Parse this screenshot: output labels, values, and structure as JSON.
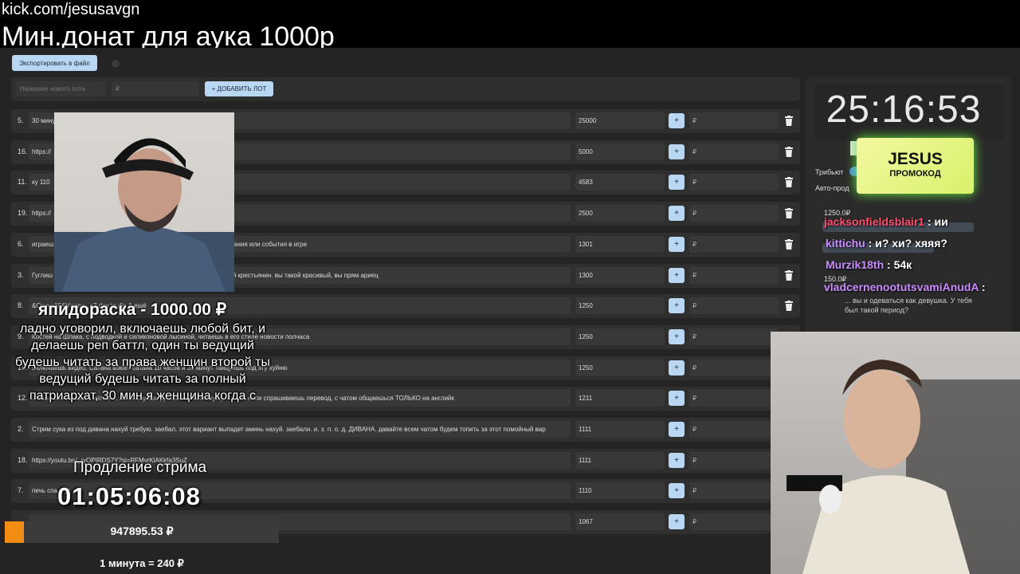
{
  "stream": {
    "url": "kick.com/jesusavgn",
    "title": "Мин.донат для аука 1000р"
  },
  "toolbar": {
    "export_label": "Экспортировать в файл"
  },
  "add_lot": {
    "name_placeholder": "Название нового лота",
    "amount_placeholder": "₽",
    "button_label": "+ ДОБАВИТЬ ЛОТ"
  },
  "lots": [
    {
      "num": "5.",
      "name": "30 минут ... ю я тебе в тг скинул",
      "amount": "25000",
      "plus": "+",
      "add_placeholder": "₽"
    },
    {
      "num": "16.",
      "name": "https://",
      "amount": "5000",
      "plus": "+",
      "add_placeholder": "₽"
    },
    {
      "num": "11.",
      "name": "ку 110",
      "amount": "4583",
      "plus": "+",
      "add_placeholder": "₽"
    },
    {
      "num": "19.",
      "name": "https://",
      "amount": "2500",
      "plus": "+",
      "add_placeholder": "₽"
    },
    {
      "num": "6.",
      "name": "играеш ... он твой компаньон читаешь донаты там тебе донатят задания или события в игре",
      "amount": "1301",
      "plus": "+",
      "add_placeholder": "₽"
    },
    {
      "num": "3.",
      "name": "Гуглиш ... фотками говоришь. Господи, какой вы ариец, а я беззубый крестьянин. вы такой красивый, вы прям ариец",
      "amount": "1300",
      "plus": "+",
      "add_placeholder": "₽"
    },
    {
      "num": "8.",
      "name": "&Осуче15&Vлоди...е7 day to die & ещё",
      "amount": "1250",
      "plus": "+",
      "add_placeholder": "₽"
    },
    {
      "num": "9.",
      "name": "Костей на Шлака, с подводкой и силиконовой лысиной, читаешь в его стиле новости полчаса",
      "amount": "1250",
      "plus": "+",
      "add_placeholder": "₽"
    },
    {
      "num": "15.",
      "name": "Включаешь видео. Сатана воюет сатана 10 часов и 30 минут танцуешь под эту хуйню",
      "amount": "1250",
      "plus": "+",
      "add_placeholder": "₽"
    },
    {
      "num": "12.",
      "name": "Учишь английский с чатом ... используешь русский по минимуму, только если спрашиваешь перевод, с чатом общаешься ТОЛЬКО на английк",
      "amount": "1211",
      "plus": "+",
      "add_placeholder": "₽"
    },
    {
      "num": "2.",
      "name": "Стрим сука из под дивана нахуй требую. заебал. этот вариант выпадет аминь нахуй. заебали. и. з. п. о. д. ДИВАНА. давайте всем чатом будем топить за этот помойный вар",
      "amount": "1111",
      "plus": "+",
      "add_placeholder": "₽"
    },
    {
      "num": "18.",
      "name": "https://youtu.be/_ryOPIRDS7Y?si=RFMvrKlAKkfa3SuZ",
      "amount": "1111",
      "plus": "+",
      "add_placeholder": "₽"
    },
    {
      "num": "7.",
      "name": "печь спа... ут",
      "amount": "1110",
      "plus": "+",
      "add_placeholder": "₽"
    },
    {
      "num": "",
      "name": "",
      "amount": "1067",
      "plus": "+",
      "add_placeholder": "₽"
    }
  ],
  "timer": {
    "value": "25:16:53",
    "tribute_label": "Трибьют",
    "auto_label": "Авто-прод"
  },
  "promo": {
    "title": "JESUS",
    "subtitle": "ПРОМОКОД"
  },
  "chat": {
    "lines": [
      {
        "amount": "1250.0₽",
        "user": "jacksonfieldsblair1",
        "text": " : ии",
        "color": "#ff4d6d"
      },
      {
        "amount": "",
        "user": "kittichu",
        "text": " : и? хи? хяяя?",
        "color": "#c98cff"
      },
      {
        "amount": "",
        "user": "Murzik18th",
        "text": " : 54к",
        "color": "#c98cff"
      },
      {
        "amount": "150.0₽",
        "user": "vladcernenootutsvamiAnudA",
        "text": " :",
        "color": "#c98cff"
      }
    ],
    "sub_text": "... вы и одеваться как девушка. У тебя был такой период?"
  },
  "donation": {
    "title": "япидораска - 1000.00 ₽",
    "message": "ладно уговорил, включаешь любой бит, и делаешь реп баттл, один ты ведущий будешь читать за права женщин второй ты ведущий будешь читать за полный патриархат, 30 мин я женщина когда с"
  },
  "extension": {
    "label": "Продление стрима",
    "timer": "01:05:06:08"
  },
  "total": {
    "value": "947895.53 ₽",
    "progress": 0.07,
    "fill_color": "#f28c13"
  },
  "rate": {
    "text": "1 минута = 240 ₽"
  },
  "colors": {
    "accent": "#b9d6f2",
    "panel": "#242424",
    "toggle": "#4a8be0",
    "promo_glow": "#6bf041"
  }
}
